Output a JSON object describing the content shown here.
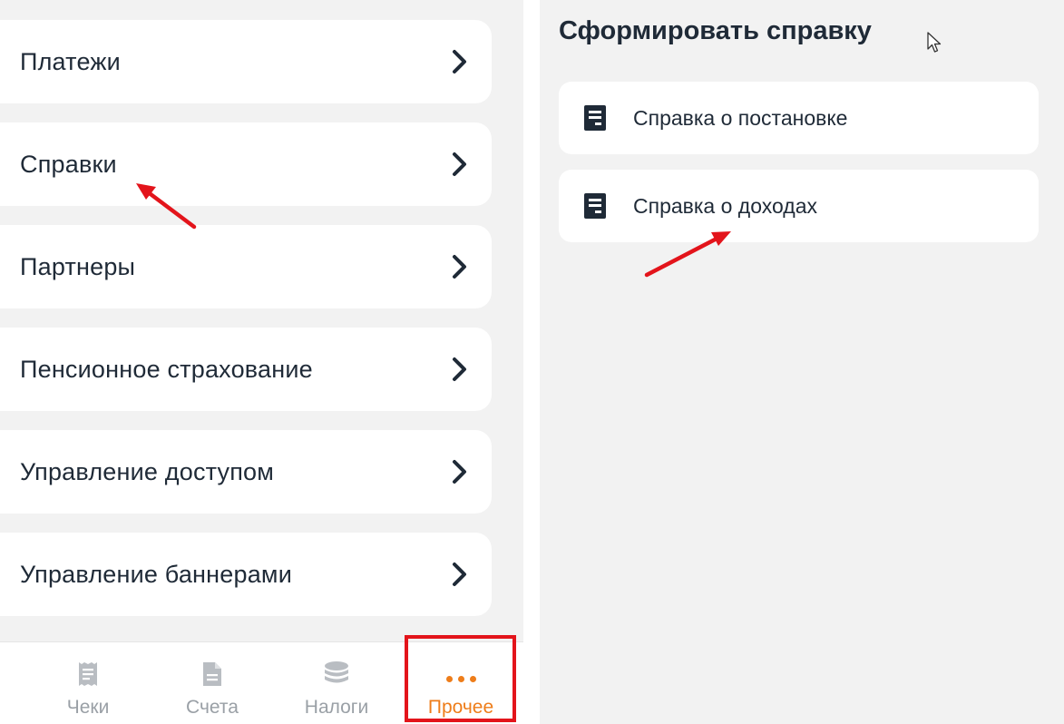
{
  "menu": {
    "items": [
      {
        "label": "Платежи"
      },
      {
        "label": "Справки"
      },
      {
        "label": "Партнеры"
      },
      {
        "label": "Пенсионное страхование"
      },
      {
        "label": "Управление доступом"
      },
      {
        "label": "Управление баннерами"
      }
    ]
  },
  "tabbar": {
    "tabs": [
      {
        "label": "Чеки",
        "icon": "receipt-icon"
      },
      {
        "label": "Счета",
        "icon": "document-icon"
      },
      {
        "label": "Налоги",
        "icon": "coins-stack-icon"
      },
      {
        "label": "Прочее",
        "icon": "more-dots-icon",
        "active": true
      }
    ]
  },
  "certificates": {
    "title": "Сформировать справку",
    "items": [
      {
        "label": "Справка о постановке",
        "icon": "document-icon"
      },
      {
        "label": "Справка о доходах",
        "icon": "document-icon"
      }
    ]
  },
  "colors": {
    "accent": "#ee7d1a",
    "annotation_red": "#e3141b",
    "text_dark": "#1f2a37",
    "tab_inactive": "#9aa0a6",
    "background": "#f2f2f2"
  }
}
